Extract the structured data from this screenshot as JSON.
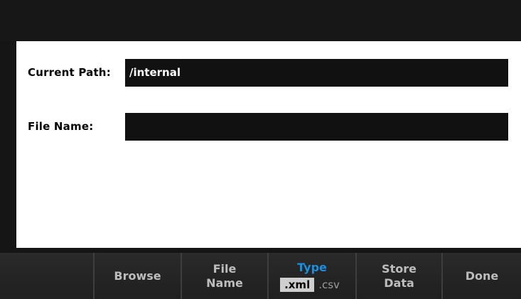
{
  "form": {
    "current_path_label": "Current Path:",
    "current_path_value": "/internal",
    "file_name_label": "File Name:",
    "file_name_value": ""
  },
  "softkeys": {
    "key1": "",
    "browse": "Browse",
    "file_name_line1": "File",
    "file_name_line2": "Name",
    "type_title": "Type",
    "type_options": [
      ".xml",
      ".csv"
    ],
    "type_selected": ".xml",
    "store_data_line1": "Store",
    "store_data_line2": "Data",
    "done": "Done"
  },
  "colors": {
    "active_title": "#1a8fe0",
    "panel_bg": "#ffffff",
    "field_bg": "#111111"
  }
}
